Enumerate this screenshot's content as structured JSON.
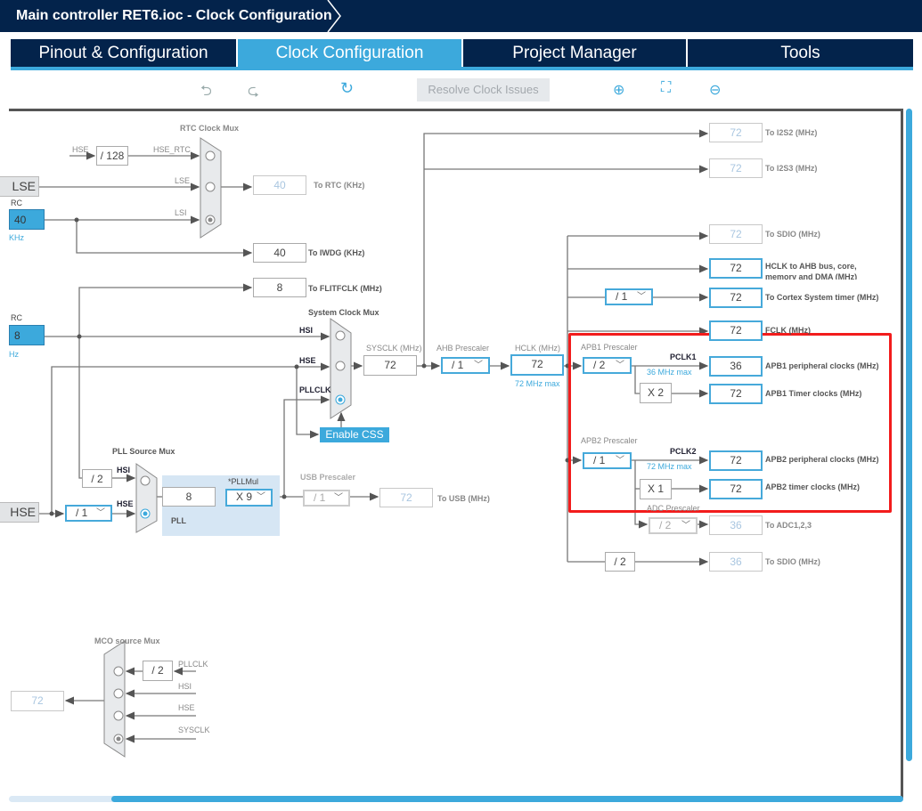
{
  "header": {
    "title": "Main controller RET6.ioc - Clock Configuration"
  },
  "tabs": [
    {
      "label": "Pinout & Configuration"
    },
    {
      "label": "Clock Configuration",
      "active": true
    },
    {
      "label": "Project Manager"
    },
    {
      "label": "Tools"
    }
  ],
  "toolbar": {
    "undo": "undo-icon",
    "redo": "redo-icon",
    "refresh": "refresh-icon",
    "resolve_label": "Resolve Clock Issues",
    "zoom_in": "zoom-in-icon",
    "fit": "fit-icon",
    "zoom_out": "zoom-out-icon"
  },
  "colors": {
    "accent": "#3ca9dc",
    "header": "#03234b",
    "highlight": "#f21c1c"
  },
  "rtc": {
    "title": "RTC Clock Mux",
    "hse": "HSE",
    "div": "/ 128",
    "hse_rtc": "HSE_RTC",
    "lse": "LSE",
    "lsi": "LSI",
    "out": "40",
    "out_label": "To RTC (KHz)",
    "selected": "LSI"
  },
  "sources": {
    "lse": "LSE",
    "lsi_rc": "RC",
    "lsi_val": "40",
    "lsi_unit": "KHz",
    "hsi_rc": "RC",
    "hsi_val": "8",
    "hsi_unit": "Hz",
    "hse": "HSE"
  },
  "iwdg": {
    "value": "40",
    "label": "To IWDG (KHz)"
  },
  "flit": {
    "value": "8",
    "label": "To FLITFCLK (MHz)"
  },
  "sysmux": {
    "title": "System Clock Mux",
    "hsi": "HSI",
    "hse": "HSE",
    "pllclk": "PLLCLK",
    "selected": "PLLCLK"
  },
  "sysclk": {
    "label": "SYSCLK (MHz)",
    "value": "72"
  },
  "ahb": {
    "label": "AHB Prescaler",
    "value": "/ 1"
  },
  "hclk": {
    "label": "HCLK (MHz)",
    "value": "72",
    "max": "72 MHz max"
  },
  "css": {
    "label": "Enable CSS"
  },
  "pllsrc": {
    "title": "PLL Source Mux",
    "div": "/ 2",
    "hsi": "HSI",
    "hse": "HSE",
    "hse_div": "/ 1",
    "selected": "HSE"
  },
  "pll": {
    "label": "PLL",
    "value": "8",
    "mul_label": "*PLLMul",
    "mul": "X 9"
  },
  "usb": {
    "label": "USB Prescaler",
    "div": "/ 1",
    "value": "72",
    "out_label": "To USB (MHz)"
  },
  "outputs": {
    "i2s2": {
      "value": "72",
      "label": "To I2S2 (MHz)"
    },
    "i2s3": {
      "value": "72",
      "label": "To I2S3 (MHz)"
    },
    "sdio": {
      "value": "72",
      "label": "To SDIO (MHz)"
    },
    "hclk_ahb": {
      "value": "72",
      "label": "HCLK to AHB bus, core,",
      "label2": "memory and DMA (MHz)"
    },
    "cortex": {
      "div": "/ 1",
      "value": "72",
      "label": "To Cortex System timer (MHz)"
    },
    "fclk": {
      "value": "72",
      "label": "FCLK (MHz)"
    },
    "apb1": {
      "label": "APB1 Prescaler",
      "div": "/ 2",
      "pclk": "PCLK1",
      "max": "36 MHz max",
      "value": "36",
      "out_label": "APB1 peripheral clocks (MHz)",
      "timer_mul": "X 2",
      "timer_value": "72",
      "timer_label": "APB1 Timer clocks (MHz)"
    },
    "apb2": {
      "label": "APB2 Prescaler",
      "div": "/ 1",
      "pclk": "PCLK2",
      "max": "72 MHz max",
      "value": "72",
      "out_label": "APB2 peripheral clocks (MHz)",
      "timer_mul": "X 1",
      "timer_value": "72",
      "timer_label": "APB2 timer clocks (MHz)"
    },
    "adc": {
      "label": "ADC Prescaler",
      "div": "/ 2",
      "value": "36",
      "out_label": "To ADC1,2,3"
    },
    "sdio2": {
      "div": "/ 2",
      "value": "36",
      "label": "To SDIO (MHz)"
    }
  },
  "mco": {
    "title": "MCO source Mux",
    "div": "/ 2",
    "pllclk": "PLLCLK",
    "hsi": "HSI",
    "hse": "HSE",
    "sysclk": "SYSCLK",
    "value": "72",
    "selected": "SYSCLK"
  }
}
